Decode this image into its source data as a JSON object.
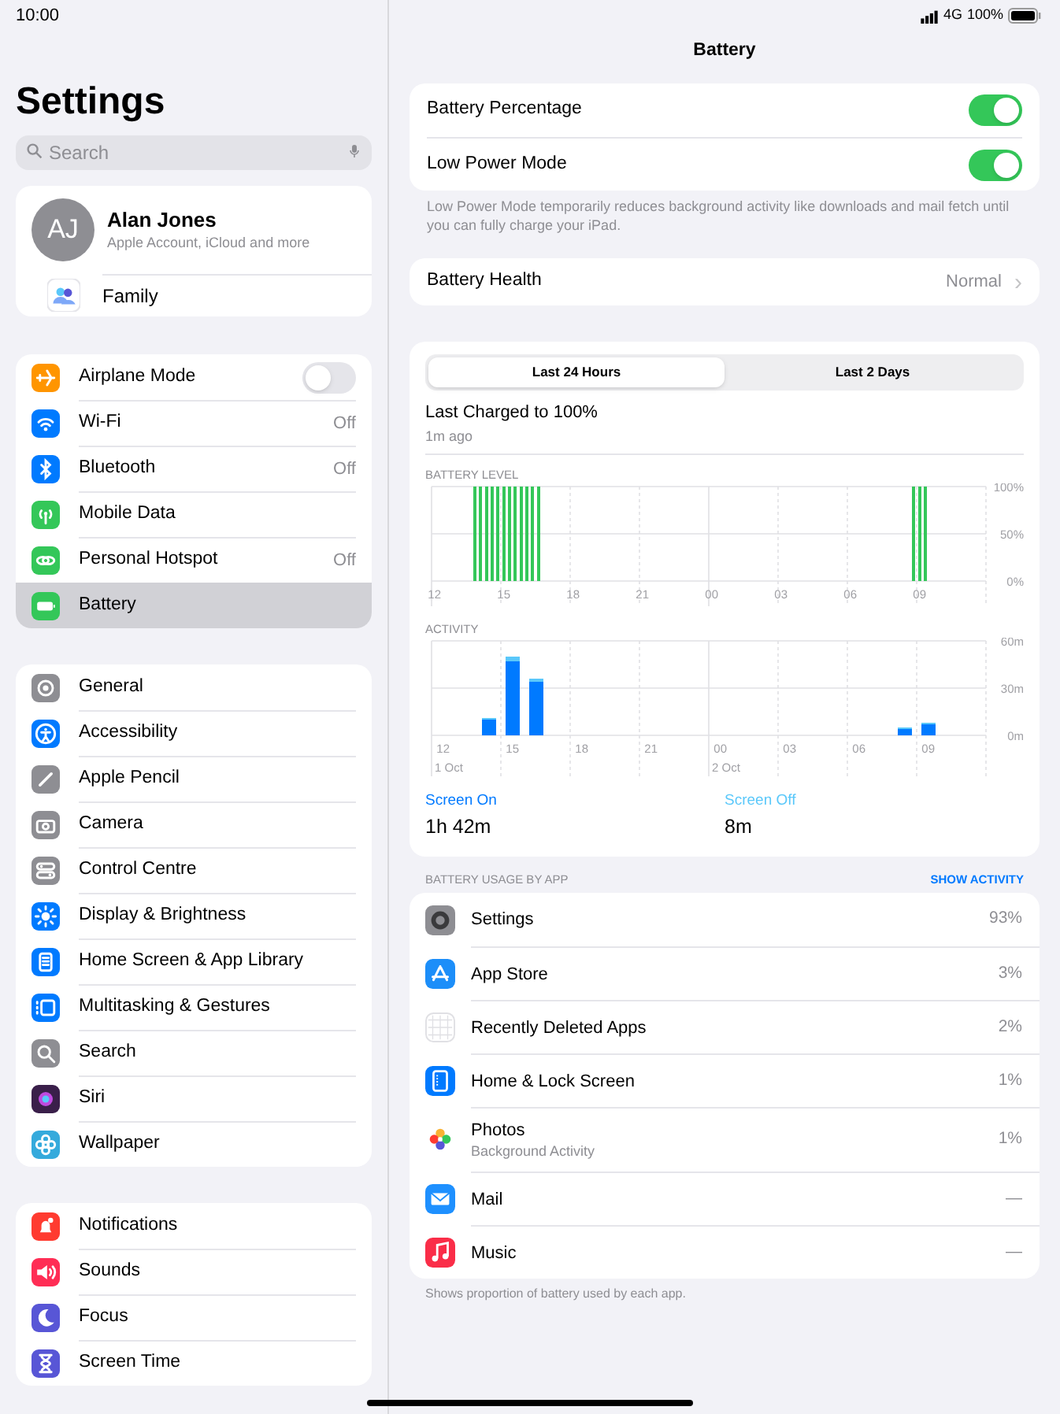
{
  "status_bar": {
    "time": "10:00",
    "network": "4G",
    "battery": "100%"
  },
  "sidebar": {
    "title": "Settings",
    "search": {
      "placeholder": "Search"
    },
    "profile": {
      "initials": "AJ",
      "name": "Alan Jones",
      "subtitle": "Apple Account, iCloud and more",
      "family": "Family"
    },
    "groups": [
      [
        {
          "label": "Airplane Mode",
          "kind": "toggle",
          "on": false,
          "color": "#ff9500",
          "selected": false
        },
        {
          "label": "Wi-Fi",
          "value": "Off",
          "color": "#007aff",
          "selected": false
        },
        {
          "label": "Bluetooth",
          "value": "Off",
          "color": "#007aff",
          "selected": false
        },
        {
          "label": "Mobile Data",
          "color": "#34c759",
          "selected": false
        },
        {
          "label": "Personal Hotspot",
          "value": "Off",
          "color": "#34c759",
          "selected": false
        },
        {
          "label": "Battery",
          "color": "#34c759",
          "selected": true
        }
      ],
      [
        {
          "label": "General",
          "color": "#8e8e93",
          "selected": false
        },
        {
          "label": "Accessibility",
          "color": "#007aff",
          "selected": false
        },
        {
          "label": "Apple Pencil",
          "color": "#8e8e93",
          "selected": false
        },
        {
          "label": "Camera",
          "color": "#8e8e93",
          "selected": false
        },
        {
          "label": "Control Centre",
          "color": "#8e8e93",
          "selected": false
        },
        {
          "label": "Display & Brightness",
          "color": "#007aff",
          "selected": false
        },
        {
          "label": "Home Screen & App Library",
          "color": "#007aff",
          "selected": false
        },
        {
          "label": "Multitasking & Gestures",
          "color": "#007aff",
          "selected": false
        },
        {
          "label": "Search",
          "color": "#8e8e93",
          "selected": false
        },
        {
          "label": "Siri",
          "color": "#3a1f4a",
          "selected": false
        },
        {
          "label": "Wallpaper",
          "color": "#35aadc",
          "selected": false
        }
      ],
      [
        {
          "label": "Notifications",
          "color": "#ff3b30",
          "selected": false
        },
        {
          "label": "Sounds",
          "color": "#ff2d55",
          "selected": false
        },
        {
          "label": "Focus",
          "color": "#5856d6",
          "selected": false
        },
        {
          "label": "Screen Time",
          "color": "#5856d6",
          "selected": false
        }
      ]
    ]
  },
  "detail": {
    "title": "Battery",
    "toggles": [
      {
        "label": "Battery Percentage",
        "on": true
      },
      {
        "label": "Low Power Mode",
        "on": true
      }
    ],
    "note": "Low Power Mode temporarily reduces background activity like downloads and mail fetch until you can fully charge your iPad.",
    "health": {
      "label": "Battery Health",
      "value": "Normal",
      "chevron": "›"
    },
    "tabs": [
      {
        "label": "Last 24 Hours",
        "selected": true
      },
      {
        "label": "Last 2 Days",
        "selected": false
      }
    ],
    "last_charged": {
      "title": "Last Charged to 100%",
      "time": "1m ago"
    },
    "battery_level": {
      "chart_data": {
        "type": "bar",
        "title": "BATTERY LEVEL",
        "ylim": [
          0,
          100
        ],
        "yticks": [
          {
            "value": 0,
            "label": "0%"
          },
          {
            "value": 50,
            "label": "50%"
          },
          {
            "value": 100,
            "label": "100%"
          }
        ],
        "categories": [
          "12",
          null,
          null,
          null,
          null,
          null,
          null,
          null,
          null,
          null,
          null,
          null,
          "15",
          null,
          null,
          null,
          null,
          null,
          null,
          null,
          null,
          null,
          null,
          null,
          "18",
          null,
          null,
          null,
          null,
          null,
          null,
          null,
          null,
          null,
          null,
          null,
          "21",
          null,
          null,
          null,
          null,
          null,
          null,
          null,
          null,
          null,
          null,
          null,
          "00",
          null,
          null,
          null,
          null,
          null,
          null,
          null,
          null,
          null,
          null,
          null,
          "03",
          null,
          null,
          null,
          null,
          null,
          null,
          null,
          null,
          null,
          null,
          null,
          "06",
          null,
          null,
          null,
          null,
          null,
          null,
          null,
          null,
          null,
          null,
          null,
          "09",
          null,
          null,
          null,
          null,
          null,
          null,
          null,
          null,
          null,
          null,
          null
        ],
        "series": [
          {
            "color": "#34c759",
            "values": [
              null,
              null,
              null,
              null,
              null,
              null,
              null,
              100,
              100,
              100,
              100,
              100,
              100,
              100,
              100,
              100,
              100,
              100,
              100,
              null,
              null,
              null,
              null,
              null,
              null,
              null,
              null,
              null,
              null,
              null,
              null,
              null,
              null,
              null,
              null,
              null,
              null,
              null,
              null,
              null,
              null,
              null,
              null,
              null,
              null,
              null,
              null,
              null,
              null,
              null,
              null,
              null,
              null,
              null,
              null,
              null,
              null,
              null,
              null,
              null,
              null,
              null,
              null,
              null,
              null,
              null,
              null,
              null,
              null,
              null,
              null,
              null,
              null,
              null,
              null,
              null,
              null,
              null,
              null,
              null,
              null,
              null,
              null,
              100,
              100,
              100,
              null,
              null,
              null,
              null,
              null,
              null,
              null,
              null,
              null,
              null
            ]
          }
        ]
      }
    },
    "activity": {
      "chart_data": {
        "type": "bar",
        "title": "ACTIVITY",
        "stacked": true,
        "ylim": [
          0,
          60
        ],
        "yticks": [
          {
            "value": 0,
            "label": "0m"
          },
          {
            "value": 30,
            "label": "30m"
          },
          {
            "value": 60,
            "label": "60m"
          }
        ],
        "categories": [
          "12",
          null,
          null,
          "15",
          null,
          null,
          "18",
          null,
          null,
          "21",
          null,
          null,
          "00",
          null,
          null,
          "03",
          null,
          null,
          "06",
          null,
          null,
          "09",
          null,
          null
        ],
        "series": [
          {
            "color": "#007aff",
            "values": [
              null,
              null,
              10,
              47,
              34,
              null,
              null,
              null,
              null,
              null,
              null,
              null,
              null,
              null,
              null,
              null,
              null,
              null,
              null,
              null,
              4,
              7,
              null,
              null
            ]
          },
          {
            "color": "#5ac8fa",
            "values": [
              null,
              null,
              1,
              3,
              2,
              null,
              null,
              null,
              null,
              null,
              null,
              null,
              null,
              null,
              null,
              null,
              null,
              null,
              null,
              null,
              1,
              1,
              null,
              null
            ]
          }
        ]
      },
      "dates": [
        "1 Oct",
        "2 Oct"
      ]
    },
    "summary": [
      {
        "label": "Screen On",
        "value": "1h 42m",
        "color": "#007aff"
      },
      {
        "label": "Screen Off",
        "value": "8m",
        "color": "#5ac8fa"
      }
    ],
    "usage_header": "BATTERY USAGE BY APP",
    "usage_action": "SHOW ACTIVITY",
    "apps": [
      {
        "name": "Settings",
        "value": "93%"
      },
      {
        "name": "App Store",
        "value": "3%"
      },
      {
        "name": "Recently Deleted Apps",
        "value": "2%"
      },
      {
        "name": "Home & Lock Screen",
        "value": "1%"
      },
      {
        "name": "Photos",
        "subtitle": "Background Activity",
        "value": "1%"
      },
      {
        "name": "Mail",
        "value": "—"
      },
      {
        "name": "Music",
        "value": "—"
      }
    ],
    "footnote": "Shows proportion of battery used by each app."
  }
}
